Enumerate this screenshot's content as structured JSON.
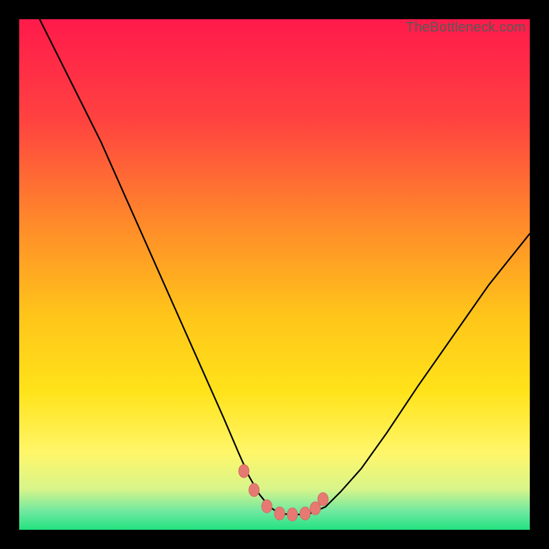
{
  "watermark": "TheBottleneck.com",
  "colors": {
    "frame": "#000000",
    "curve_stroke": "#000000",
    "marker_fill": "#e67a73",
    "marker_stroke": "#d46a63",
    "gradient_stops": [
      {
        "offset": 0.0,
        "color": "#ff1a4b"
      },
      {
        "offset": 0.2,
        "color": "#ff4340"
      },
      {
        "offset": 0.4,
        "color": "#ff8a2a"
      },
      {
        "offset": 0.58,
        "color": "#ffc51a"
      },
      {
        "offset": 0.73,
        "color": "#ffe31a"
      },
      {
        "offset": 0.85,
        "color": "#fff66a"
      },
      {
        "offset": 0.92,
        "color": "#d8f58a"
      },
      {
        "offset": 0.965,
        "color": "#6de8a0"
      },
      {
        "offset": 1.0,
        "color": "#23e27f"
      }
    ]
  },
  "chart_data": {
    "type": "line",
    "title": "",
    "xlabel": "",
    "ylabel": "",
    "xlim": [
      0,
      100
    ],
    "ylim": [
      0,
      100
    ],
    "grid": false,
    "legend": false,
    "series": [
      {
        "name": "bottleneck-curve",
        "x": [
          4,
          8,
          12,
          16,
          20,
          24,
          28,
          32,
          36,
          40,
          43,
          45,
          47,
          49,
          51,
          53,
          55,
          57,
          60,
          63,
          67,
          72,
          78,
          85,
          92,
          100
        ],
        "values": [
          100,
          92,
          84,
          76,
          67,
          58,
          49,
          40,
          31,
          22,
          15,
          10.5,
          7,
          4.5,
          3.2,
          3.0,
          3.0,
          3.2,
          4.5,
          7.5,
          12,
          19,
          28,
          38,
          48,
          58
        ]
      }
    ],
    "markers": {
      "name": "critical-points",
      "x": [
        44,
        46,
        48.5,
        51,
        53.5,
        56,
        58,
        59.5
      ],
      "values": [
        11.5,
        7.8,
        4.6,
        3.2,
        3.0,
        3.2,
        4.2,
        6.0
      ]
    }
  }
}
